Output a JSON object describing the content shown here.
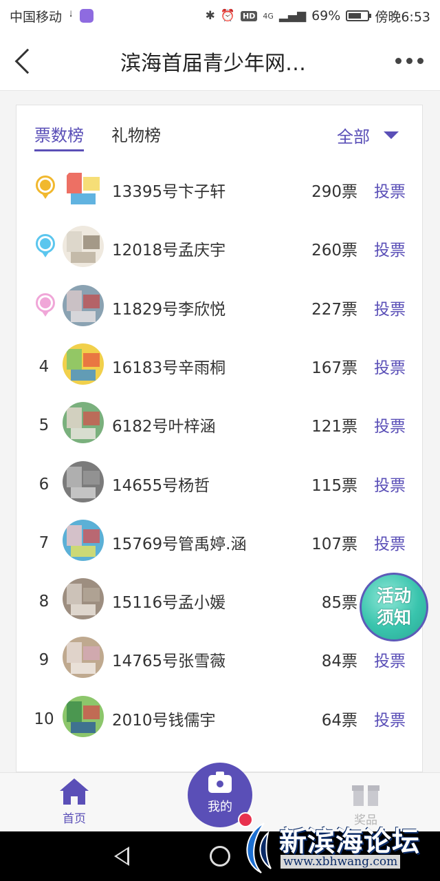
{
  "status_bar": {
    "carrier": "中国移动",
    "network": "4G",
    "battery": "69%",
    "battery_level": 0.69,
    "time": "傍晚6:53",
    "hd": "HD"
  },
  "header": {
    "title": "滨海首届青少年网…"
  },
  "tabs": [
    {
      "label": "票数榜",
      "active": true
    },
    {
      "label": "礼物榜",
      "active": false
    }
  ],
  "filter": {
    "label": "全部"
  },
  "vote_label": "投票",
  "ranking": [
    {
      "rank": "1",
      "name": "13395号卞子轩",
      "votes": "290票",
      "medal": "gold"
    },
    {
      "rank": "2",
      "name": "12018号孟庆宇",
      "votes": "260票",
      "medal": "blue"
    },
    {
      "rank": "3",
      "name": "11829号李欣悦",
      "votes": "227票",
      "medal": "pink"
    },
    {
      "rank": "4",
      "name": "16183号辛雨桐",
      "votes": "167票"
    },
    {
      "rank": "5",
      "name": "6182号叶梓涵",
      "votes": "121票"
    },
    {
      "rank": "6",
      "name": "14655号杨哲",
      "votes": "115票"
    },
    {
      "rank": "7",
      "name": "15769号管禹婷.涵",
      "votes": "107票"
    },
    {
      "rank": "8",
      "name": "15116号孟小媛",
      "votes": "85票"
    },
    {
      "rank": "9",
      "name": "14765号张雪薇",
      "votes": "84票"
    },
    {
      "rank": "10",
      "name": "2010号钱儒宇",
      "votes": "64票"
    }
  ],
  "notice_fab": {
    "line1": "活动",
    "line2": "须知"
  },
  "bottom_nav": {
    "home": "首页",
    "mine": "我的",
    "prize": "奖品"
  },
  "watermark": {
    "title": "新滨海论坛",
    "url": "www.xbhwang.com"
  },
  "colors": {
    "accent": "#5a4fb7",
    "gold": "#f1b82e",
    "blue": "#5bc6ee",
    "pink": "#f0a6d8"
  }
}
